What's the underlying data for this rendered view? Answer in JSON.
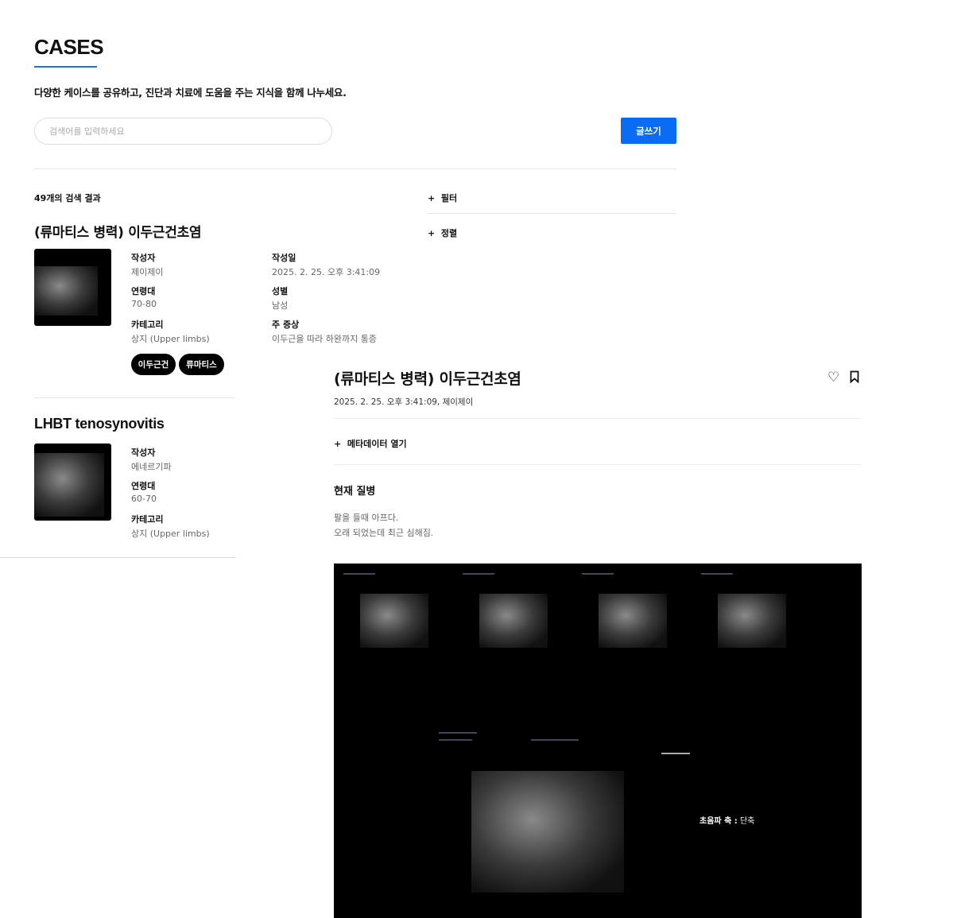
{
  "header": {
    "title": "CASES",
    "subtitle": "다양한 케이스를 공유하고, 진단과 치료에 도움을 주는 지식을 함께 나누세요.",
    "search_placeholder": "검색어를 입력하세요",
    "write_label": "글쓰기",
    "accent": "#1a73e8",
    "button_color": "#0a6cf5"
  },
  "results": {
    "count_label": "49개의 검색 결과",
    "filter_label": "필터",
    "sort_label": "정렬"
  },
  "cases": [
    {
      "title": "(류마티스 병력) 이두근건초염",
      "author_label": "작성자",
      "author": "제이제이",
      "age_label": "연령대",
      "age": "70-80",
      "category_label": "카테고리",
      "category": "상지 (Upper limbs)",
      "date_label": "작성일",
      "date": "2025. 2. 25. 오후 3:41:09",
      "sex_label": "성별",
      "sex": "남성",
      "symptom_label": "주 증상",
      "symptom": "이두근을 따라 하완까지 통증",
      "tags": [
        "이두근건",
        "류마티스"
      ]
    },
    {
      "title": "LHBT tenosynovitis",
      "author_label": "작성자",
      "author": "에네르기파",
      "age_label": "연령대",
      "age": "60-70",
      "category_label": "카테고리",
      "category": "상지 (Upper limbs)"
    }
  ],
  "detail": {
    "title": "(류마티스 병력) 이두근건초염",
    "meta": "2025. 2. 25. 오후 3:41:09, 제이제이",
    "metadata_toggle": "메타데이터 열기",
    "section_title": "현재 질병",
    "body_lines": [
      "팔을 들때 아프다.",
      "오래 되었는데 최근 심해짐."
    ],
    "axis_label": "초음파 축 :",
    "axis_value": "단축",
    "icons": [
      "heart-icon",
      "bookmark-icon"
    ]
  }
}
